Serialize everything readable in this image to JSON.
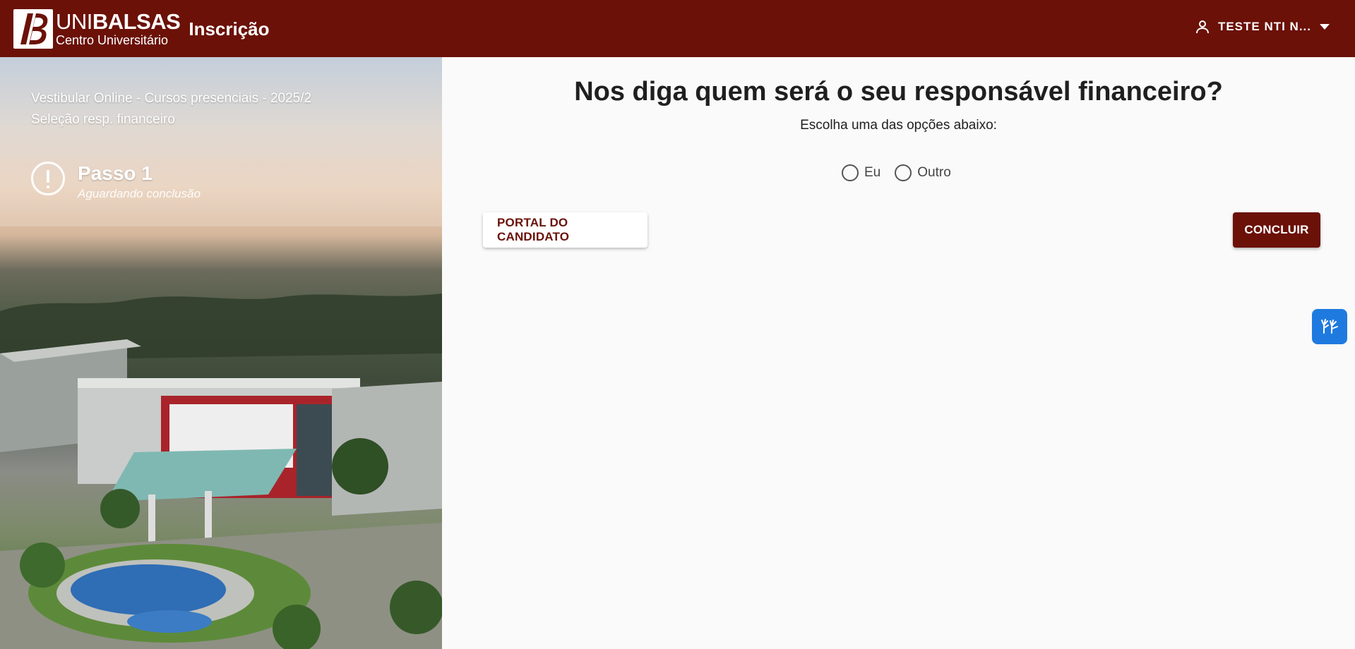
{
  "header": {
    "logo": {
      "uni": "UNI",
      "balsas": "BALSAS",
      "subtitle": "Centro Universitário"
    },
    "app_title": "Inscrição",
    "user": {
      "name": "TESTE NTI N...",
      "icon": "user-icon",
      "menu_icon": "caret-down-icon"
    }
  },
  "sidebar": {
    "title_line1": "Vestibular Online - Cursos presenciais - 2025/2",
    "title_line2": "Seleção resp. financeiro",
    "step": {
      "label": "Passo 1",
      "status": "Aguardando conclusão",
      "icon": "exclamation-circle-icon"
    }
  },
  "main": {
    "question": "Nos diga quem será o seu responsável financeiro?",
    "instruction": "Escolha uma das opções abaixo:",
    "options": [
      {
        "label": "Eu",
        "selected": false
      },
      {
        "label": "Outro",
        "selected": false
      }
    ],
    "portal_button": "PORTAL DO CANDIDATO",
    "submit_button": "CONCLUIR"
  },
  "accessibility_widget": {
    "icon": "sign-language-hands-icon"
  },
  "colors": {
    "brand": "#6b1108",
    "accent_blue": "#1f7ae0",
    "background": "#fafafa"
  }
}
